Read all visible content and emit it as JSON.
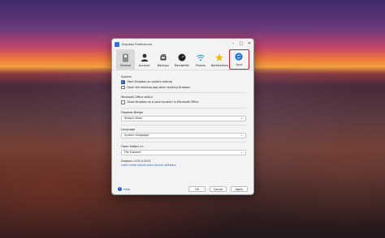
{
  "window": {
    "title": "Dropbox Preferences",
    "minimize": "–",
    "maximize": "□",
    "close": "✕"
  },
  "tabs": [
    {
      "label": "General",
      "icon": "switch-icon"
    },
    {
      "label": "Account",
      "icon": "person-icon"
    },
    {
      "label": "Backups",
      "icon": "backups-icon"
    },
    {
      "label": "Bandwidth",
      "icon": "gauge-icon"
    },
    {
      "label": "Proxies",
      "icon": "wifi-icon"
    },
    {
      "label": "Notifications",
      "icon": "star-icon"
    },
    {
      "label": "Sync",
      "icon": "sync-icon"
    }
  ],
  "general": {
    "system_label": "System",
    "start_on_startup": "Start Dropbox on system startup",
    "open_desktop_app": "Open the desktop app when starting Dropbox",
    "office_label": "Microsoft Office add-in",
    "show_dropbox_office": "Show Dropbox as a save location in Microsoft Office",
    "badge_label": "Dropbox Badge",
    "badge_value": "Always show",
    "language_label": "Language",
    "language_value": "System Language",
    "folders_label": "Open folders in:",
    "folders_value": "File Explorer",
    "version": "Dropbox v135.4.4301",
    "learn_more": "Learn more about open source software"
  },
  "footer": {
    "help": "Help",
    "ok": "OK",
    "cancel": "Cancel",
    "apply": "Apply"
  }
}
